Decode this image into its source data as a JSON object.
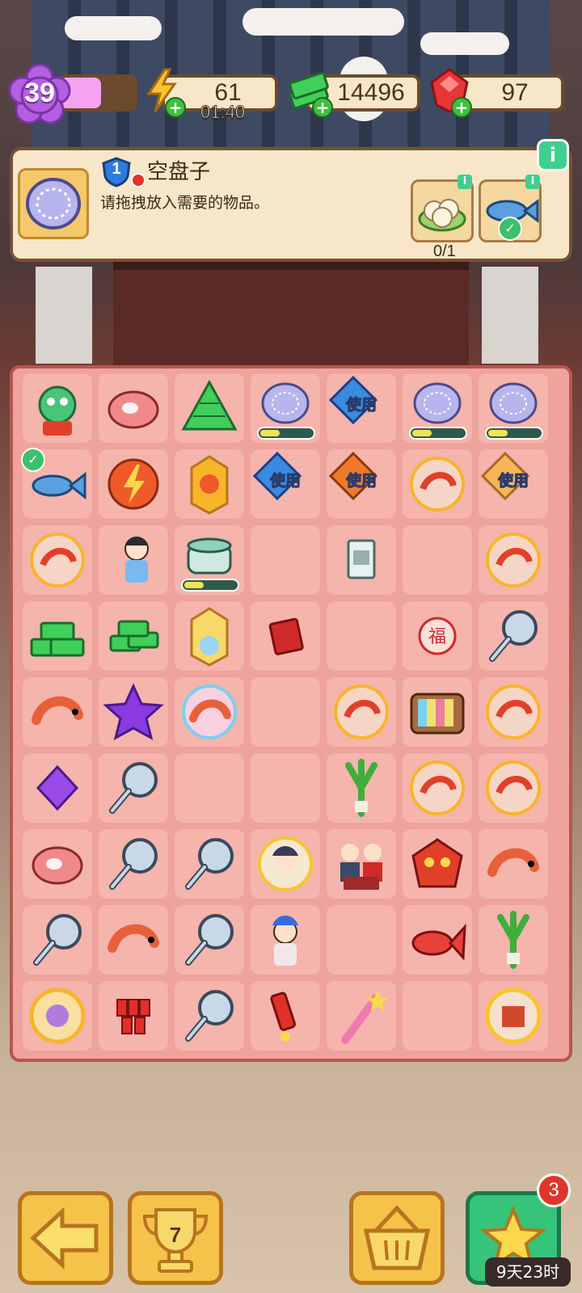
{
  "hud": {
    "level": "39",
    "xp_fraction": 0.55,
    "energy": "61",
    "energy_timer": "01:40",
    "cash": "14496",
    "gems": "97"
  },
  "info_panel": {
    "item_name": "空盘子",
    "item_level": "1",
    "description": "请拖拽放入需要的物品。",
    "requirement_progress": "0/1",
    "info_label": "i",
    "mini_info_label": "i"
  },
  "board": {
    "use_label": "使用",
    "rows": [
      [
        "lion-dance",
        "steak",
        "cash-pile",
        "plate",
        "use-blue",
        "plate",
        "plate"
      ],
      [
        "fish",
        "energy-orb",
        "dragon-lantern",
        "use-blue",
        "use-orange",
        "shrimp-bubble",
        "use-gold"
      ],
      [
        "shrimp-bubble",
        "opera-girl",
        "pot",
        "empty",
        "seed-packet",
        "empty",
        "shrimp-bubble"
      ],
      [
        "cash-stack",
        "cash-small",
        "nian-lantern",
        "red-envelope",
        "empty",
        "fu-seal",
        "frying-pan"
      ],
      [
        "shrimp",
        "purple-star",
        "shrimp-rainbow",
        "empty",
        "shrimp-bubble",
        "tv",
        "shrimp-bubble"
      ],
      [
        "purple-gem",
        "frying-pan",
        "empty",
        "empty",
        "scallion",
        "shrimp-bubble",
        "shrimp-bubble"
      ],
      [
        "steak",
        "frying-pan",
        "frying-pan",
        "opera-bubble",
        "family",
        "dragon-mask",
        "shrimp"
      ],
      [
        "frying-pan",
        "shrimp",
        "frying-pan",
        "opera-girl2",
        "empty",
        "red-fish",
        "scallion"
      ],
      [
        "gold-bubble",
        "firecrackers",
        "frying-pan",
        "rocket",
        "sparkler",
        "empty",
        "gift-bubble"
      ]
    ],
    "progress_cells": [
      [
        0,
        3
      ],
      [
        0,
        5
      ],
      [
        0,
        6
      ],
      [
        2,
        2
      ]
    ],
    "checked_cells": [
      [
        1,
        0
      ]
    ]
  },
  "bottom": {
    "trophy_count": "7",
    "star_badge": "3",
    "event_timer": "9天23时"
  },
  "colors": {
    "board_bg": "#eea39c",
    "cell_bg": "#f5b4ac",
    "panel_bg": "#f7e7c8",
    "accent_green": "#35c47a",
    "accent_gold": "#f5c24a"
  }
}
